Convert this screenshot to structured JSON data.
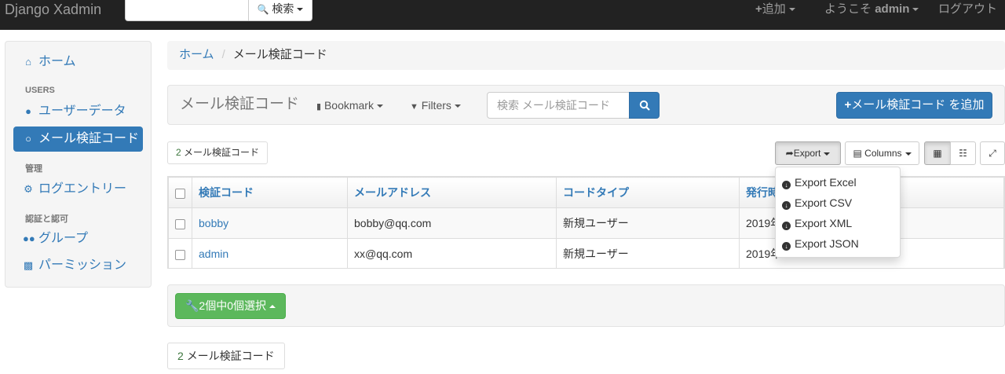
{
  "navbar": {
    "brand": "Django Xadmin",
    "search_placeholder": "",
    "search_button": "検索",
    "add_label": "追加",
    "welcome_prefix": "ようこそ",
    "username": "admin",
    "logout": "ログアウト"
  },
  "sidebar": {
    "home": "ホーム",
    "sections": [
      {
        "heading": "USERS",
        "items": [
          "ユーザーデータ",
          "メール検証コード"
        ]
      },
      {
        "heading": "管理",
        "items": [
          "ログエントリー"
        ]
      },
      {
        "heading": "認証と認可",
        "items": [
          "グループ",
          "パーミッション"
        ]
      }
    ],
    "active_item": "メール検証コード"
  },
  "breadcrumb": {
    "home": "ホーム",
    "current": "メール検証コード"
  },
  "toolbar": {
    "title": "メール検証コード",
    "bookmark": "Bookmark",
    "filters": "Filters",
    "search_placeholder": "検索 メール検証コード",
    "add_button": "メール検証コード を追加"
  },
  "result_count": {
    "num": "2",
    "label": "メール検証コード"
  },
  "controls": {
    "export": "Export",
    "columns": "Columns"
  },
  "export_menu": [
    "Export Excel",
    "Export CSV",
    "Export XML",
    "Export JSON"
  ],
  "table": {
    "headers": [
      "検証コード",
      "メールアドレス",
      "コードタイプ",
      "発行時"
    ],
    "rows": [
      {
        "code": "bobby",
        "email": "bobby@qq.com",
        "type": "新規ユーザー",
        "time": "2019年"
      },
      {
        "code": "admin",
        "email": "xx@qq.com",
        "type": "新規ユーザー",
        "time": "2019年"
      }
    ]
  },
  "actions": {
    "button": "2個中0個選択"
  },
  "bottom_count": {
    "num": "2",
    "label": "メール検証コード"
  },
  "colors": {
    "navbar": "#222222",
    "primary": "#337ab7",
    "success": "#5cb85c",
    "panel": "#f5f5f5"
  }
}
